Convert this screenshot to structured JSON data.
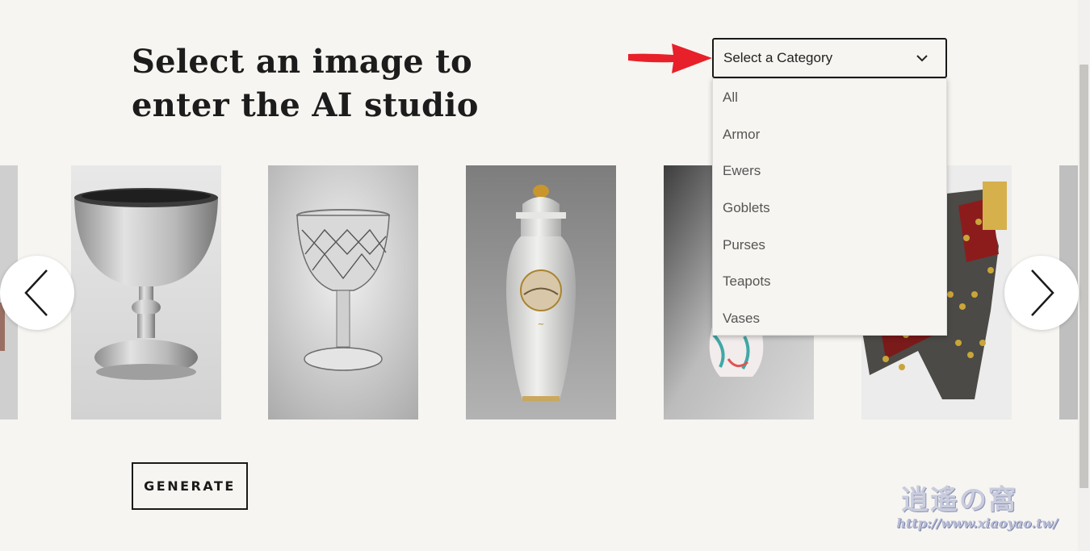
{
  "heading": {
    "line1": "Select an image to",
    "line2": "enter the AI studio"
  },
  "category_select": {
    "label": "Select a Category",
    "options": [
      "All",
      "Armor",
      "Ewers",
      "Goblets",
      "Purses",
      "Teapots",
      "Vases"
    ]
  },
  "carousel": {
    "items": [
      "goblet-silver",
      "goblet-cut-glass",
      "covered-vase",
      "ewer",
      "armor"
    ]
  },
  "generate_label": "GENERATE",
  "watermark": {
    "logo": "逍遙の窩",
    "url": "http://www.xiaoyao.tw/"
  },
  "colors": {
    "background": "#f7f5f1",
    "arrow": "#e8202a",
    "text": "#1c1c1c"
  }
}
